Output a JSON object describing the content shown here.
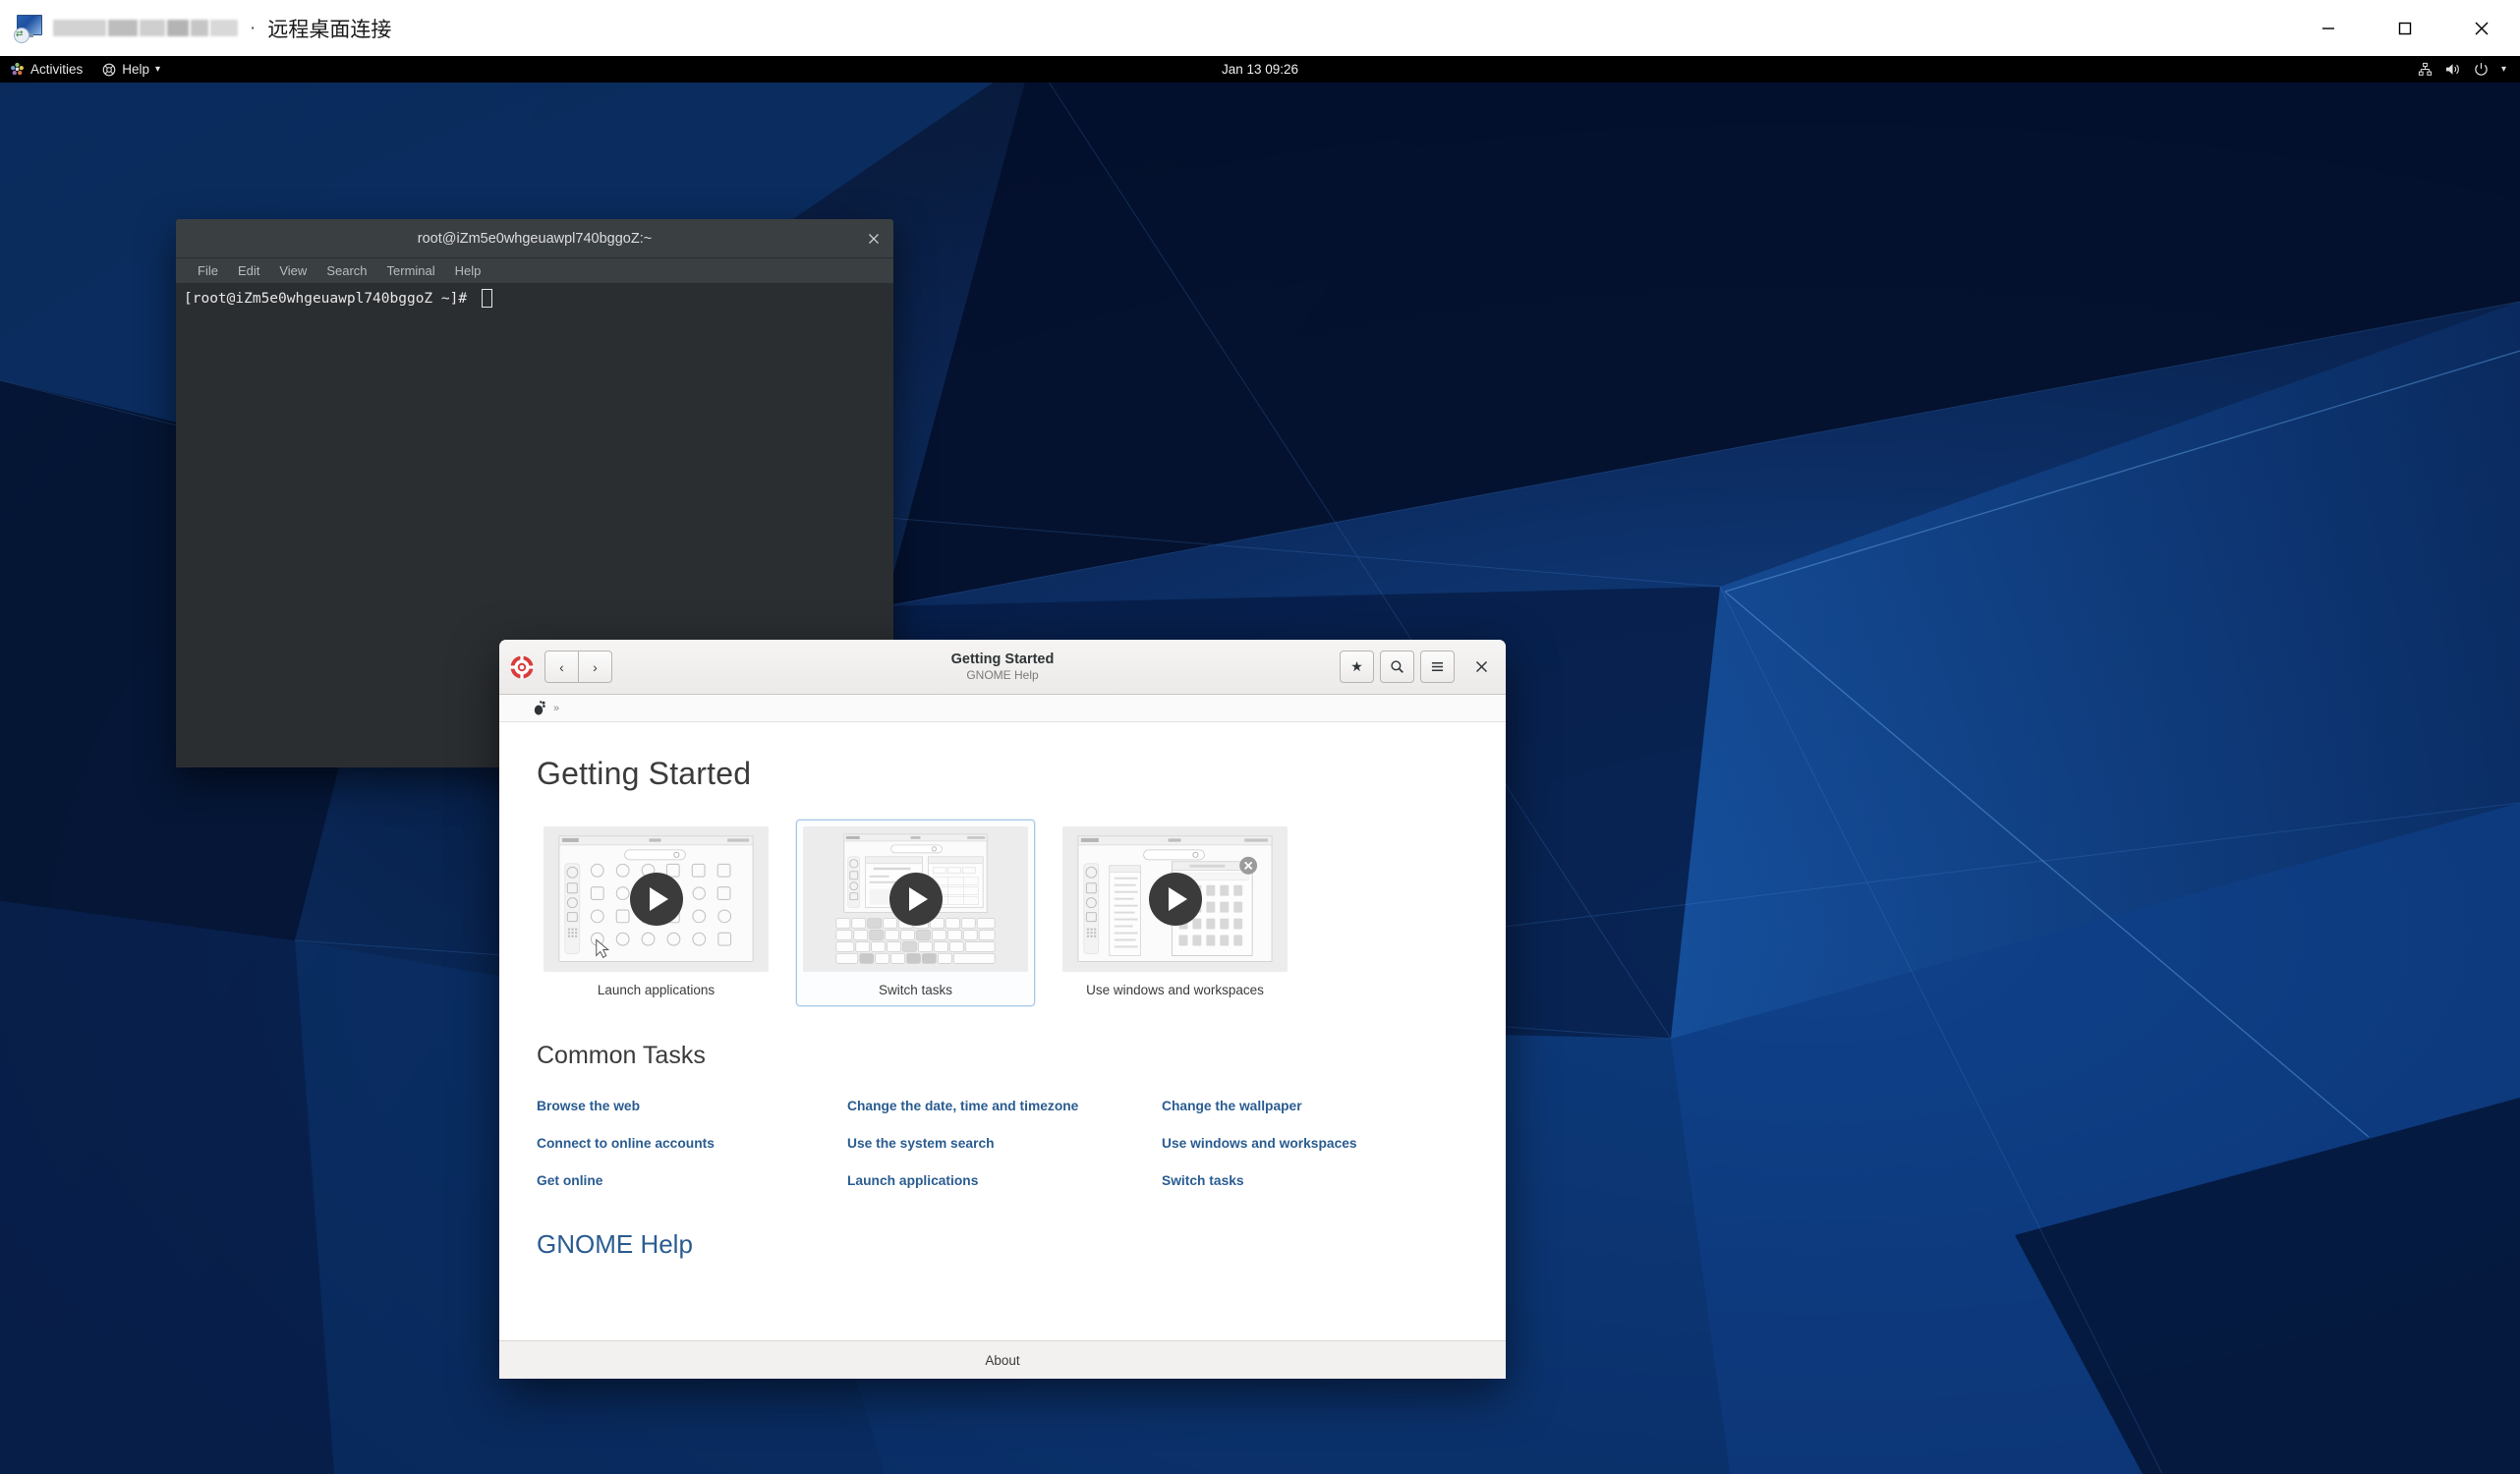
{
  "rdp": {
    "title_suffix": "远程桌面连接",
    "separator": "·",
    "icon": "remote-desktop-icon",
    "window_buttons": {
      "minimize": "—",
      "maximize": "□",
      "close": "✕"
    }
  },
  "topbar": {
    "activities": "Activities",
    "activities_icon": "gnome-activities-icon",
    "app_menu": "Help",
    "app_menu_icon": "lifebuoy-icon",
    "app_menu_arrow": "▾",
    "clock": "Jan 13  09:26",
    "tray": {
      "network_icon": "network-icon",
      "volume_icon": "volume-icon",
      "power_icon": "power-icon",
      "arrow": "▾"
    }
  },
  "terminal": {
    "title": "root@iZm5e0whgeuawpl740bggoZ:~",
    "close_label": "✕",
    "menus": [
      "File",
      "Edit",
      "View",
      "Search",
      "Terminal",
      "Help"
    ],
    "prompt": "[root@iZm5e0whgeuawpl740bggoZ ~]# "
  },
  "help": {
    "app_icon": "lifebuoy-icon",
    "nav": {
      "back": "‹",
      "forward": "›"
    },
    "title": "Getting Started",
    "subtitle": "GNOME Help",
    "header_buttons": {
      "bookmarks": "★",
      "search": "search-icon",
      "menu": "≡",
      "close": "✕"
    },
    "breadcrumb": {
      "home_icon": "gnome-foot-icon",
      "separator": "»"
    },
    "page_heading": "Getting Started",
    "videos": [
      {
        "caption": "Launch applications",
        "thumb": "app-grid-thumbnail",
        "selected": false
      },
      {
        "caption": "Switch tasks",
        "thumb": "keyboard-switch-thumbnail",
        "selected": true
      },
      {
        "caption": "Use windows and workspaces",
        "thumb": "windows-workspaces-thumbnail",
        "selected": false
      }
    ],
    "common_tasks_heading": "Common Tasks",
    "tasks": [
      "Browse the web",
      "Change the date, time and timezone",
      "Change the wallpaper",
      "Connect to online accounts",
      "Use the system search",
      "Use windows and workspaces",
      "Get online",
      "Launch applications",
      "Switch tasks"
    ],
    "gnome_help_link": "GNOME Help",
    "about_button": "About"
  },
  "colors": {
    "link": "#2a5c91",
    "heading": "#3b3b3b",
    "selected_card_border": "#a9c8e8",
    "topbar_bg": "#000000",
    "terminal_bg": "#2b2e31",
    "terminal_titlebar": "#3a3f42",
    "desktop_base": "#0a1e47"
  }
}
